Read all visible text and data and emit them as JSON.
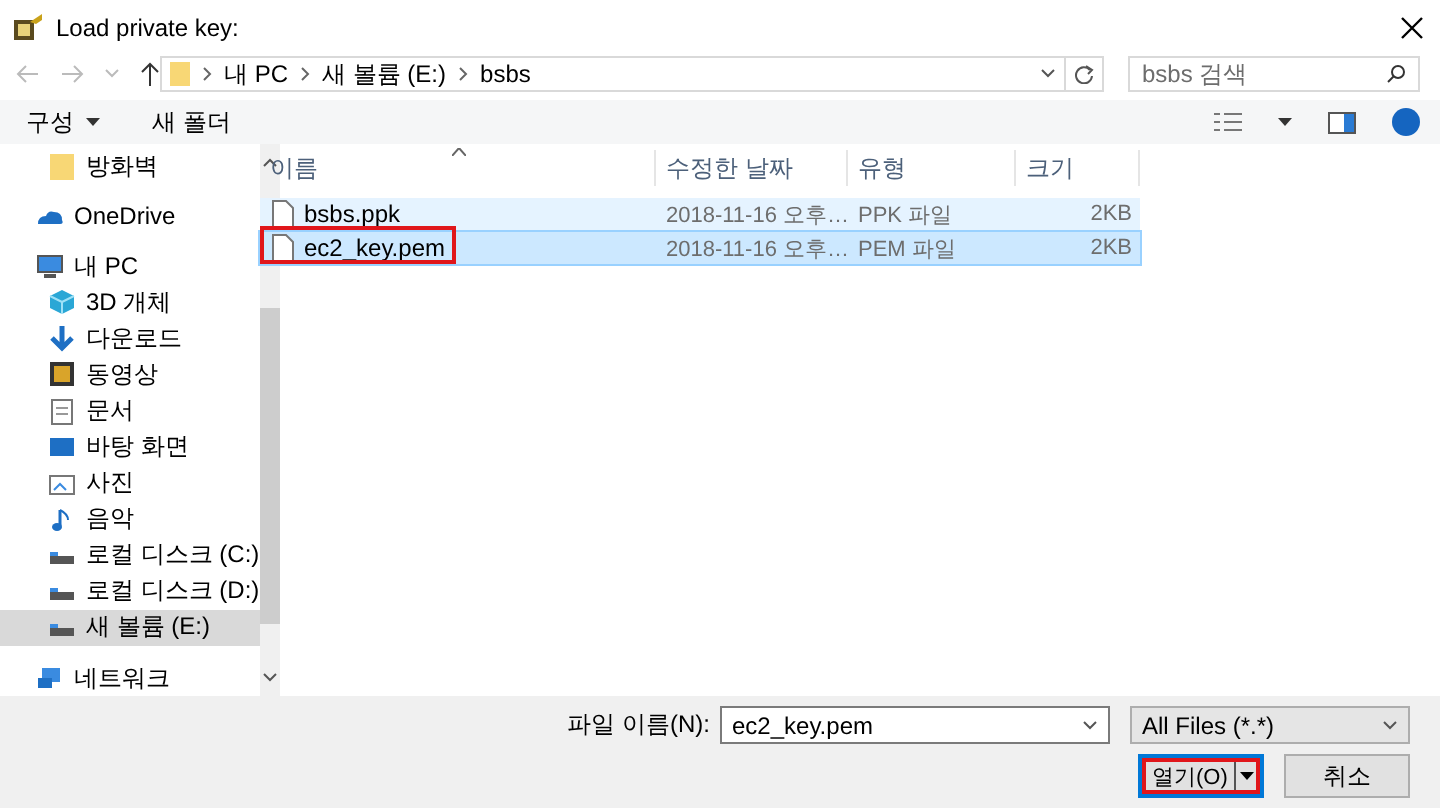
{
  "window": {
    "title": "Load private key:"
  },
  "address": {
    "path": [
      "내 PC",
      "새 볼륨 (E:)",
      "bsbs"
    ]
  },
  "search": {
    "placeholder": "bsbs 검색"
  },
  "toolbar": {
    "organize": "구성",
    "new_folder": "새 폴더"
  },
  "nav": {
    "items": [
      {
        "label": "방화벽",
        "kind": "folder",
        "selected": false,
        "indent": true
      },
      {
        "label": "OneDrive",
        "kind": "cloud",
        "selected": false,
        "indent": false
      },
      {
        "label": "내 PC",
        "kind": "pc",
        "selected": false,
        "indent": false
      },
      {
        "label": "3D 개체",
        "kind": "cube",
        "selected": false,
        "indent": true
      },
      {
        "label": "다운로드",
        "kind": "download",
        "selected": false,
        "indent": true
      },
      {
        "label": "동영상",
        "kind": "video",
        "selected": false,
        "indent": true
      },
      {
        "label": "문서",
        "kind": "document",
        "selected": false,
        "indent": true
      },
      {
        "label": "바탕 화면",
        "kind": "desktop",
        "selected": false,
        "indent": true
      },
      {
        "label": "사진",
        "kind": "photo",
        "selected": false,
        "indent": true
      },
      {
        "label": "음악",
        "kind": "music",
        "selected": false,
        "indent": true
      },
      {
        "label": "로컬 디스크 (C:)",
        "kind": "drive",
        "selected": false,
        "indent": true
      },
      {
        "label": "로컬 디스크 (D:)",
        "kind": "drive",
        "selected": false,
        "indent": true
      },
      {
        "label": "새 볼륨 (E:)",
        "kind": "drive",
        "selected": true,
        "indent": true
      },
      {
        "label": "네트워크",
        "kind": "network",
        "selected": false,
        "indent": false
      }
    ]
  },
  "columns": [
    "이름",
    "수정한 날짜",
    "유형",
    "크기"
  ],
  "files": [
    {
      "name": "bsbs.ppk",
      "modified": "2018-11-16 오후…",
      "type": "PPK 파일",
      "size": "2KB",
      "selected": true,
      "focused": false,
      "annotated": false
    },
    {
      "name": "ec2_key.pem",
      "modified": "2018-11-16 오후…",
      "type": "PEM 파일",
      "size": "2KB",
      "selected": true,
      "focused": true,
      "annotated": true
    }
  ],
  "footer": {
    "filename_label": "파일 이름(N):",
    "filename": "ec2_key.pem",
    "filter": "All Files (*.*)",
    "buttons": [
      {
        "label": "열기(O)",
        "kind": "split",
        "annotated": true
      },
      {
        "label": "취소",
        "kind": "plain",
        "annotated": false
      }
    ]
  }
}
